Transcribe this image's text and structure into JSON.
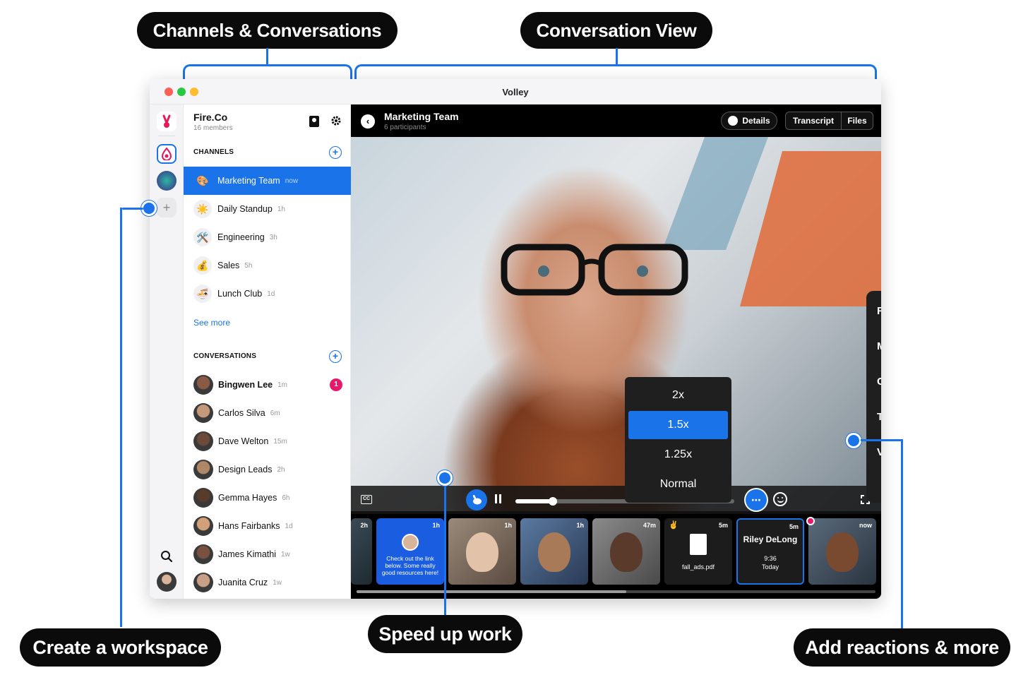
{
  "callouts": {
    "channels": "Channels & Conversations",
    "conversation_view": "Conversation View",
    "workspace": "Create a workspace",
    "speed": "Speed up work",
    "reactions": "Add reactions & more"
  },
  "window": {
    "title": "Volley"
  },
  "workspace": {
    "name": "Fire.Co",
    "members": "16 members"
  },
  "channels": {
    "title": "CHANNELS",
    "items": [
      {
        "label": "Marketing Team",
        "time": "now",
        "icon": "palette-emoji",
        "active": true
      },
      {
        "label": "Daily Standup",
        "time": "1h",
        "icon": "sun-emoji"
      },
      {
        "label": "Engineering",
        "time": "3h",
        "icon": "tools-emoji"
      },
      {
        "label": "Sales",
        "time": "5h",
        "icon": "money-bag-emoji"
      },
      {
        "label": "Lunch Club",
        "time": "1d",
        "icon": "food-bowl-emoji"
      }
    ],
    "see_more": "See more"
  },
  "conversations": {
    "title": "CONVERSATIONS",
    "items": [
      {
        "label": "Bingwen Lee",
        "time": "1m",
        "unread": "1"
      },
      {
        "label": "Carlos Silva",
        "time": "6m"
      },
      {
        "label": "Dave Welton",
        "time": "15m"
      },
      {
        "label": "Design Leads",
        "time": "2h"
      },
      {
        "label": "Gemma Hayes",
        "time": "6h"
      },
      {
        "label": "Hans Fairbanks",
        "time": "1d"
      },
      {
        "label": "James Kimathi",
        "time": "1w"
      },
      {
        "label": "Juanita Cruz",
        "time": "1w"
      }
    ]
  },
  "conversation": {
    "title": "Marketing Team",
    "participants": "6 participants",
    "details_label": "Details",
    "transcript_label": "Transcript",
    "files_label": "Files"
  },
  "playback": {
    "cc_label": "CC",
    "speed_options": [
      "2x",
      "1.5x",
      "1.25x",
      "Normal"
    ],
    "selected_speed": "1.5x",
    "progress": 0.17
  },
  "context_menu": {
    "items": [
      {
        "label": "Forward",
        "icon": "forward-arrow-icon"
      },
      {
        "label": "Mark for follow up",
        "icon": "flag-icon"
      },
      {
        "label": "Copy public link",
        "icon": "link-icon"
      },
      {
        "label": "Talk to Cai",
        "icon": "chat-arrow-icon"
      },
      {
        "label": "View details",
        "icon": "info-icon"
      }
    ],
    "reactions": [
      "✌️",
      "💯",
      "😂",
      "🙂",
      "🔥"
    ]
  },
  "thumbnails": [
    {
      "time": "2h"
    },
    {
      "time": "1h",
      "text": "Check out the link below. Some really good resources here!"
    },
    {
      "time": "1h"
    },
    {
      "time": "1h"
    },
    {
      "time": "47m"
    },
    {
      "time": "5m",
      "file": "fall_ads.pdf"
    },
    {
      "time": "5m",
      "name": "Riley DeLong",
      "duration": "9:36",
      "day": "Today"
    },
    {
      "time": "now"
    }
  ],
  "colors": {
    "accent": "#1a73e8",
    "unread": "#e8196a"
  }
}
